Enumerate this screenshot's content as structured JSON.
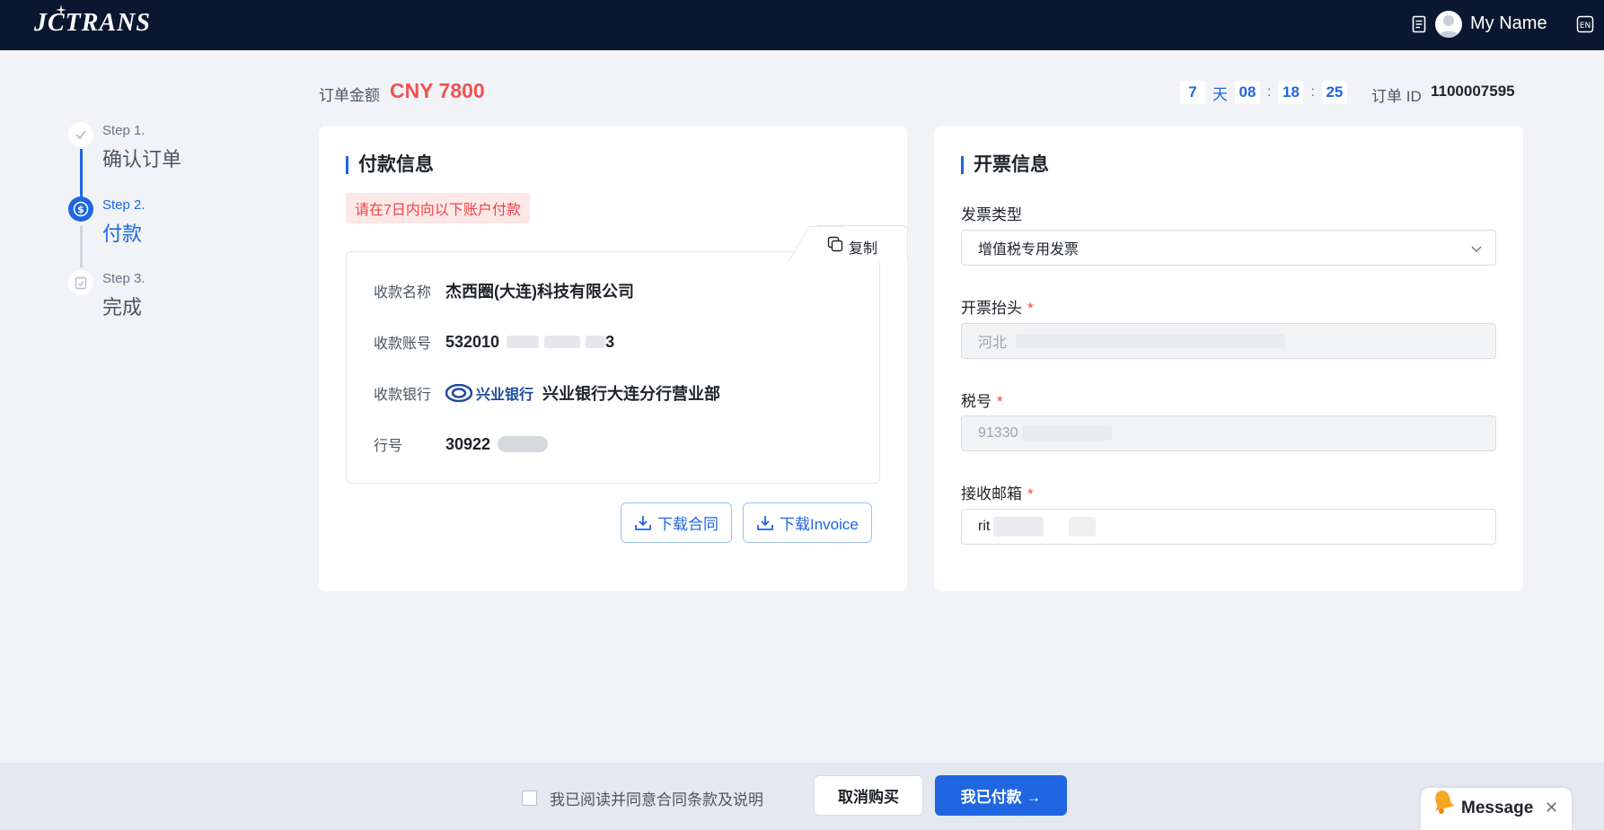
{
  "header": {
    "logo_text": "JCTRANS",
    "username": "My Name"
  },
  "steps": [
    {
      "num": "Step 1.",
      "title": "确认订单",
      "state": "done"
    },
    {
      "num": "Step 2.",
      "title": "付款",
      "state": "current"
    },
    {
      "num": "Step 3.",
      "title": "完成",
      "state": "pending"
    }
  ],
  "order": {
    "amount_label": "订单金额",
    "amount": "CNY 7800",
    "countdown": {
      "days": "7",
      "day_unit": "天",
      "hours": "08",
      "minutes": "18",
      "seconds": "25",
      "separator": ":"
    },
    "id_label": "订单 ID",
    "id": "1100007595"
  },
  "payment": {
    "title": "付款信息",
    "notice": "请在7日内向以下账户付款",
    "copy_label": "复制",
    "rows": {
      "payee_label": "收款名称",
      "payee_value": "杰西圈(大连)科技有限公司",
      "account_label": "收款账号",
      "account_value_prefix": "532010",
      "account_value_suffix": "3",
      "bank_label": "收款银行",
      "bank_logo": "兴业银行",
      "bank_value": "兴业银行大连分行营业部",
      "bank_no_label": "行号",
      "bank_no_value": "30922"
    },
    "download_contract": "下载合同",
    "download_invoice": "下载Invoice"
  },
  "invoice": {
    "title": "开票信息",
    "type_label": "发票类型",
    "type_value": "增值税专用发票",
    "header_label": "开票抬头",
    "header_value": "河北",
    "tax_label": "税号",
    "tax_value": "91330",
    "email_label": "接收邮箱",
    "email_value": "rit",
    "required_mark": "*"
  },
  "footer": {
    "agree_text": "我已阅读并同意合同条款及说明",
    "cancel": "取消购买",
    "paid": "我已付款 →",
    "message": "Message",
    "close": "✕"
  },
  "colors": {
    "topbar": "#0b1730",
    "accent": "#1f66e0",
    "amount": "#f05252",
    "background": "#f2f3f7"
  }
}
